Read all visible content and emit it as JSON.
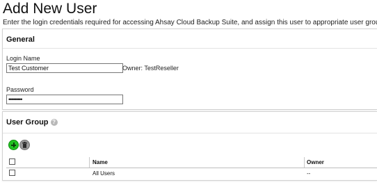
{
  "page": {
    "title": "Add New User",
    "intro": "Enter the login credentials required for accessing Ahsay Cloud Backup Suite, and assign this user to appropriate user groups."
  },
  "general": {
    "title": "General",
    "login_label": "Login Name",
    "login_value": "Test Customer",
    "owner_text": "Owner: TestReseller",
    "password_label": "Password",
    "password_value": "•••••••••"
  },
  "user_group": {
    "title": "User Group",
    "help_icon": "?",
    "add_icon": "plus-icon",
    "delete_icon": "trash-icon",
    "columns": {
      "name": "Name",
      "owner": "Owner"
    },
    "rows": [
      {
        "name": "All Users",
        "owner": "--"
      }
    ]
  },
  "colors": {
    "add_green": "#22c122",
    "delete_gray": "#9a9a9a"
  }
}
